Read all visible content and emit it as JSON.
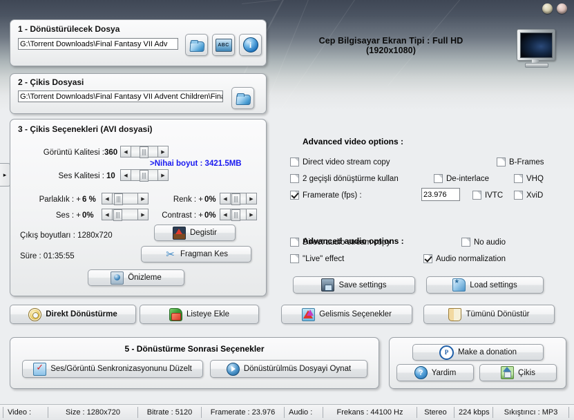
{
  "window": {
    "minimize_label": "_",
    "close_label": "x"
  },
  "header": {
    "screen_type": "Cep Bilgisayar Ekran Tipi : Full HD (1920x1080)",
    "tv_icon": "tv-monitor-icon"
  },
  "section1": {
    "title": "1 - Dönüstürülecek Dosya",
    "input_value": "G:\\Torrent Downloads\\Final Fantasy VII Adv",
    "buttons": [
      {
        "name": "browse-input-file",
        "icon": "folder-icon"
      },
      {
        "name": "subtitle-file",
        "icon": "abc-icon",
        "label": "ABC"
      },
      {
        "name": "file-info",
        "icon": "info-icon",
        "label": "i"
      }
    ]
  },
  "section2": {
    "title": "2 - Çikis Dosyasi",
    "input_value": "G:\\Torrent Downloads\\Final Fantasy VII Advent Children\\Fina",
    "browse_icon": "folder-icon"
  },
  "section3": {
    "title": "3 - Çikis Seçenekleri (AVI dosyasi)",
    "video_quality_label": "Görüntü Kalitesi :",
    "video_quality_value": "360",
    "audio_quality_label": "Ses Kalitesi :",
    "audio_quality_value": "10",
    "final_size": ">Nihai boyut : 3421.5MB",
    "brightness_label": "Parlaklık : +",
    "brightness_value": "6 %",
    "volume_label": "Ses : +",
    "volume_value": "0%",
    "color_label": "Renk : +",
    "color_value": "0%",
    "contrast_label": "Contrast : +",
    "contrast_value": "0%",
    "output_dims": "Çıkış boyutları : 1280x720",
    "duration": "Süre : 01:35:55",
    "change_button": "Degistir",
    "trim_button": "Fragman Kes",
    "preview_button": "Önizleme"
  },
  "advanced_video": {
    "title": "Advanced video options :",
    "options": [
      {
        "label": "Direct video stream copy",
        "checked": false
      },
      {
        "label": "2 geçişli dönüştürme kullan",
        "checked": false
      },
      {
        "label": "Framerate (fps) :",
        "checked": true
      },
      {
        "label": "De-interlace",
        "checked": false
      },
      {
        "label": "B-Frames",
        "checked": false
      },
      {
        "label": "VHQ",
        "checked": false
      },
      {
        "label": "IVTC",
        "checked": false
      },
      {
        "label": "XviD",
        "checked": false
      }
    ],
    "framerate_value": "23.976"
  },
  "advanced_audio": {
    "title": "Advanced audio options :",
    "options": [
      {
        "label": "Direct audio stream copy",
        "checked": false
      },
      {
        "label": "\"Live\" effect",
        "checked": false
      },
      {
        "label": "No audio",
        "checked": false
      },
      {
        "label": "Audio normalization",
        "checked": true
      }
    ]
  },
  "settings_buttons": {
    "save": "Save settings",
    "load": "Load settings"
  },
  "action_buttons": {
    "direct_convert": "Direkt Dönüstürme",
    "add_to_list": "Listeye Ekle",
    "advanced_options": "Gelismis Seçenekler",
    "convert_all": "Tümünü Dönüstür"
  },
  "section5": {
    "title": "5 - Dönüstürme Sonrasi Seçenekler",
    "fix_sync": "Ses/Görüntü Senkronizasyonunu Düzelt",
    "play_converted": "Dönüstürülmüs Dosyayi Oynat"
  },
  "support": {
    "donation": "Make a donation",
    "help": "Yardim",
    "exit": "Çikis"
  },
  "statusbar": {
    "cells": [
      "Video :",
      "Size : 1280x720",
      "Bitrate : 5120",
      "Framerate : 23.976",
      "Audio :",
      "Frekans : 44100 Hz",
      "Stereo",
      "224 kbps",
      "Sıkıştırıcı : MP3"
    ]
  },
  "expander": {
    "arrow": "▸"
  }
}
